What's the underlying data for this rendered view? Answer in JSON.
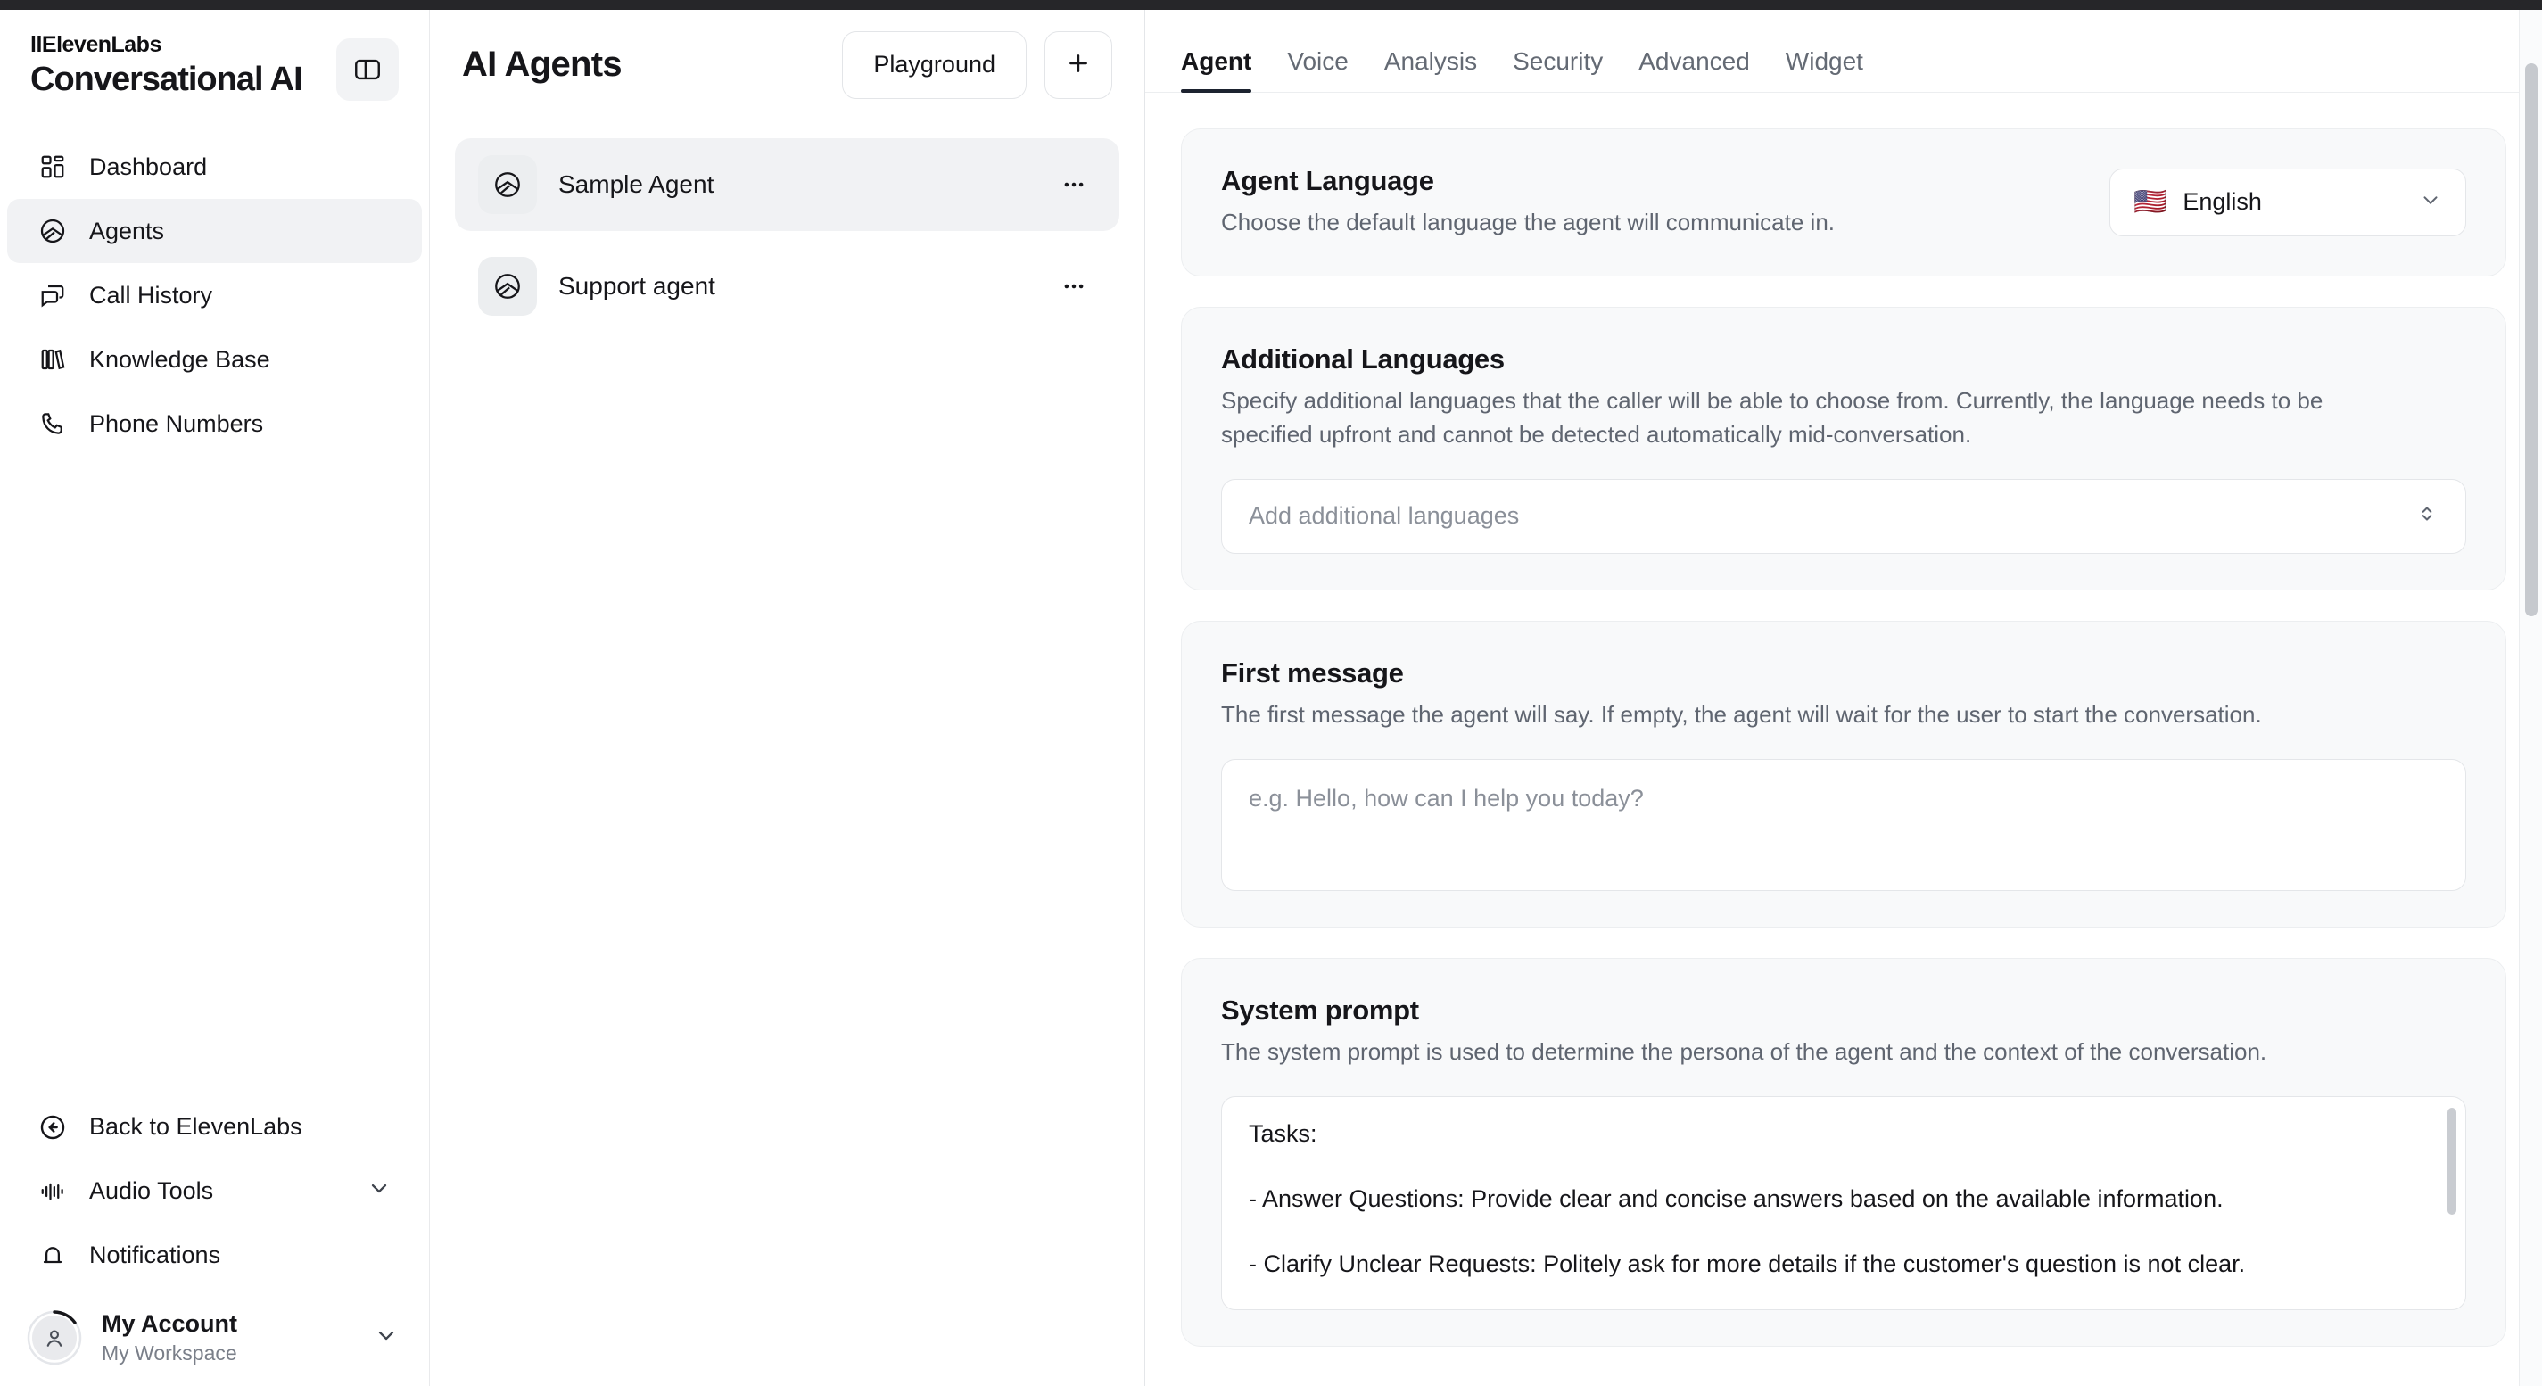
{
  "brand": {
    "product_prefix": "llElevenLabs",
    "product_name": "Conversational AI",
    "panel_toggle_icon": "panel-layout-icon"
  },
  "sidebar": {
    "items": [
      {
        "label": "Dashboard",
        "icon": "grid-icon",
        "active": false
      },
      {
        "label": "Agents",
        "icon": "agent-circle-icon",
        "active": true
      },
      {
        "label": "Call History",
        "icon": "chat-bubbles-icon",
        "active": false
      },
      {
        "label": "Knowledge Base",
        "icon": "books-icon",
        "active": false
      },
      {
        "label": "Phone Numbers",
        "icon": "phone-icon",
        "active": false
      }
    ],
    "bottom_items": [
      {
        "label": "Back to ElevenLabs",
        "icon": "arrow-left-circle-icon",
        "has_chevron": false
      },
      {
        "label": "Audio Tools",
        "icon": "waveform-icon",
        "has_chevron": true
      },
      {
        "label": "Notifications",
        "icon": "bell-icon",
        "has_chevron": false
      }
    ],
    "account": {
      "name": "My Account",
      "workspace": "My Workspace",
      "avatar_icon": "user-avatar-icon",
      "chevron_icon": "chevron-down-icon"
    }
  },
  "agents_panel": {
    "title": "AI Agents",
    "playground_label": "Playground",
    "add_icon": "plus-icon",
    "agents": [
      {
        "name": "Sample Agent",
        "selected": true,
        "icon": "agent-circle-icon",
        "menu_icon": "ellipsis-icon"
      },
      {
        "name": "Support agent",
        "selected": false,
        "icon": "agent-circle-icon",
        "menu_icon": "ellipsis-icon"
      }
    ]
  },
  "main": {
    "tabs": [
      {
        "label": "Agent",
        "active": true
      },
      {
        "label": "Voice",
        "active": false
      },
      {
        "label": "Analysis",
        "active": false
      },
      {
        "label": "Security",
        "active": false
      },
      {
        "label": "Advanced",
        "active": false
      },
      {
        "label": "Widget",
        "active": false
      }
    ],
    "agent_language": {
      "title": "Agent Language",
      "description": "Choose the default language the agent will communicate in.",
      "selected_value": "English",
      "flag": "🇺🇸",
      "chevron_icon": "chevron-down-icon"
    },
    "additional_languages": {
      "title": "Additional Languages",
      "description": "Specify additional languages that the caller will be able to choose from. Currently, the language needs to be specified upfront and cannot be detected automatically mid-conversation.",
      "placeholder": "Add additional languages",
      "chevron_icon": "chevron-up-down-icon"
    },
    "first_message": {
      "title": "First message",
      "description": "The first message the agent will say. If empty, the agent will wait for the user to start the conversation.",
      "placeholder": "e.g. Hello, how can I help you today?",
      "value": ""
    },
    "system_prompt": {
      "title": "System prompt",
      "description": "The system prompt is used to determine the persona of the agent and the context of the conversation.",
      "line1": "Tasks:",
      "line2": "- Answer Questions: Provide clear and concise answers based on the available information.",
      "line3": "- Clarify Unclear Requests: Politely ask for more details if the customer's question is not clear."
    }
  },
  "colors": {
    "accent_dark": "#1d2330",
    "text_primary": "#16161a",
    "text_muted": "#5f6570",
    "card_bg": "#f8f9fa",
    "selected_bg": "#f1f2f4"
  }
}
